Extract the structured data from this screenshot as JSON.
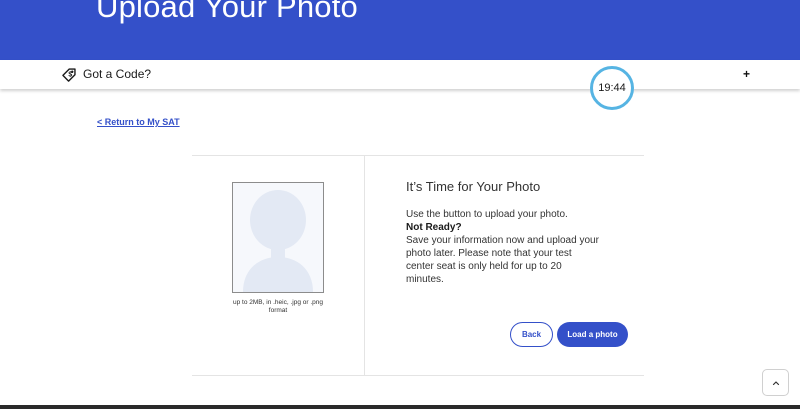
{
  "header": {
    "title": "Upload Your Photo",
    "color": "#3450c9"
  },
  "code_bar": {
    "icon": "tag-icon",
    "label": "Got a Code?",
    "expand_icon": "plus-icon",
    "expand_label": "+"
  },
  "timer": {
    "value": "19:44",
    "ring_color": "#56b4e3"
  },
  "nav": {
    "return_link": "< Return to My SAT"
  },
  "photo_panel": {
    "placeholder_icon": "person-silhouette-icon",
    "caption": "up to 2MB, in .heic, .jpg or .png format"
  },
  "info_panel": {
    "heading": "It’s Time for Your Photo",
    "instruction": "Use the button to upload your photo.",
    "not_ready": "Not Ready?",
    "note": "Save your information now and upload your photo later. Please note that your test center seat is only held for up to 20 minutes."
  },
  "actions": {
    "back_label": "Back",
    "load_label": "Load a photo"
  },
  "scroll_top": {
    "icon": "chevron-up-icon"
  }
}
